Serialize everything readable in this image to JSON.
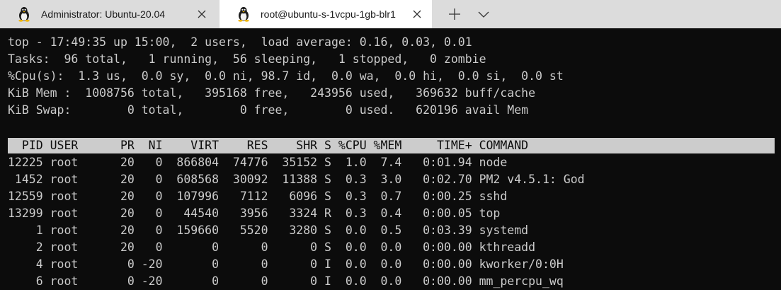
{
  "tabs": [
    {
      "title": "Administrator: Ubuntu-20.04",
      "icon": "linux-tux-icon",
      "active": false
    },
    {
      "title": "root@ubuntu-s-1vcpu-1gb-blr1",
      "icon": "linux-tux-icon",
      "active": true
    }
  ],
  "terminal": {
    "summary": [
      "top - 17:49:35 up 15:00,  2 users,  load average: 0.16, 0.03, 0.01",
      "Tasks:  96 total,   1 running,  56 sleeping,   1 stopped,   0 zombie",
      "%Cpu(s):  1.3 us,  0.0 sy,  0.0 ni, 98.7 id,  0.0 wa,  0.0 hi,  0.0 si,  0.0 st",
      "KiB Mem :  1008756 total,   395168 free,   243956 used,   369632 buff/cache",
      "KiB Swap:        0 total,        0 free,        0 used.   620196 avail Mem"
    ],
    "process_header": "  PID USER      PR  NI    VIRT    RES    SHR S %CPU %MEM     TIME+ COMMAND",
    "processes": [
      "12225 root      20   0  866804  74776  35152 S  1.0  7.4   0:01.94 node",
      " 1452 root      20   0  608568  30092  11388 S  0.3  3.0   0:02.70 PM2 v4.5.1: God",
      "12559 root      20   0  107996   7112   6096 S  0.3  0.7   0:00.25 sshd",
      "13299 root      20   0   44540   3956   3324 R  0.3  0.4   0:00.05 top",
      "    1 root      20   0  159660   5520   3280 S  0.0  0.5   0:03.39 systemd",
      "    2 root      20   0       0      0      0 S  0.0  0.0   0:00.00 kthreadd",
      "    4 root       0 -20       0      0      0 I  0.0  0.0   0:00.00 kworker/0:0H",
      "    6 root       0 -20       0      0      0 I  0.0  0.0   0:00.00 mm_percpu_wq"
    ]
  },
  "colors": {
    "terminal_bg": "#0c0c0c",
    "terminal_fg": "#cccccc",
    "tabbar_bg": "#dcdcdc",
    "active_tab_bg": "#ffffff"
  }
}
